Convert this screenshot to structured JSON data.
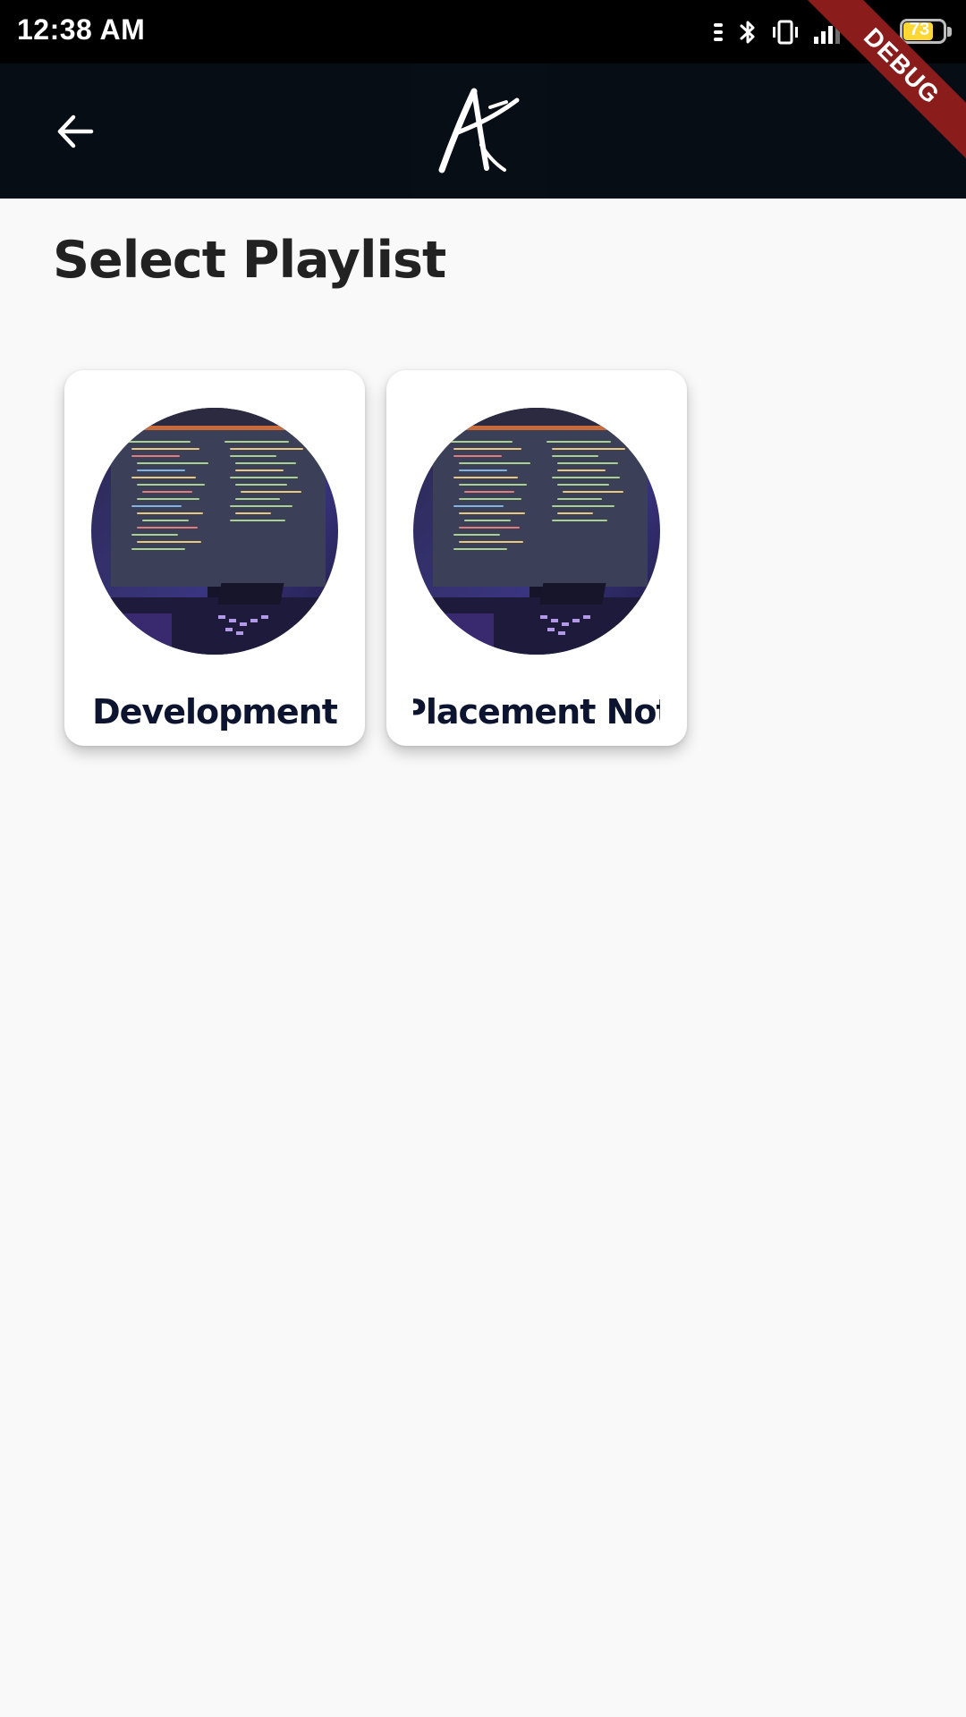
{
  "status_bar": {
    "time": "12:38 AM",
    "battery_level": "73",
    "icons": [
      "notification-dots-icon",
      "bluetooth-icon",
      "vibrate-icon",
      "signal-icon",
      "wifi-icon",
      "battery-icon"
    ]
  },
  "app_bar": {
    "back_icon": "arrow-back-icon",
    "logo": "A"
  },
  "debug_banner": "DEBUG",
  "page": {
    "title": "Select Playlist"
  },
  "playlists": [
    {
      "label": "Development",
      "thumbnail": "code-monitor-image"
    },
    {
      "label": "Placement Not",
      "thumbnail": "code-monitor-image"
    }
  ],
  "colors": {
    "status_bar_bg": "#000000",
    "app_bar_bg": "#060d14",
    "page_bg": "#f9f9f9",
    "card_bg": "#ffffff",
    "card_label": "#0c1430",
    "title": "#222222",
    "debug_ribbon": "#8b1c1c"
  }
}
